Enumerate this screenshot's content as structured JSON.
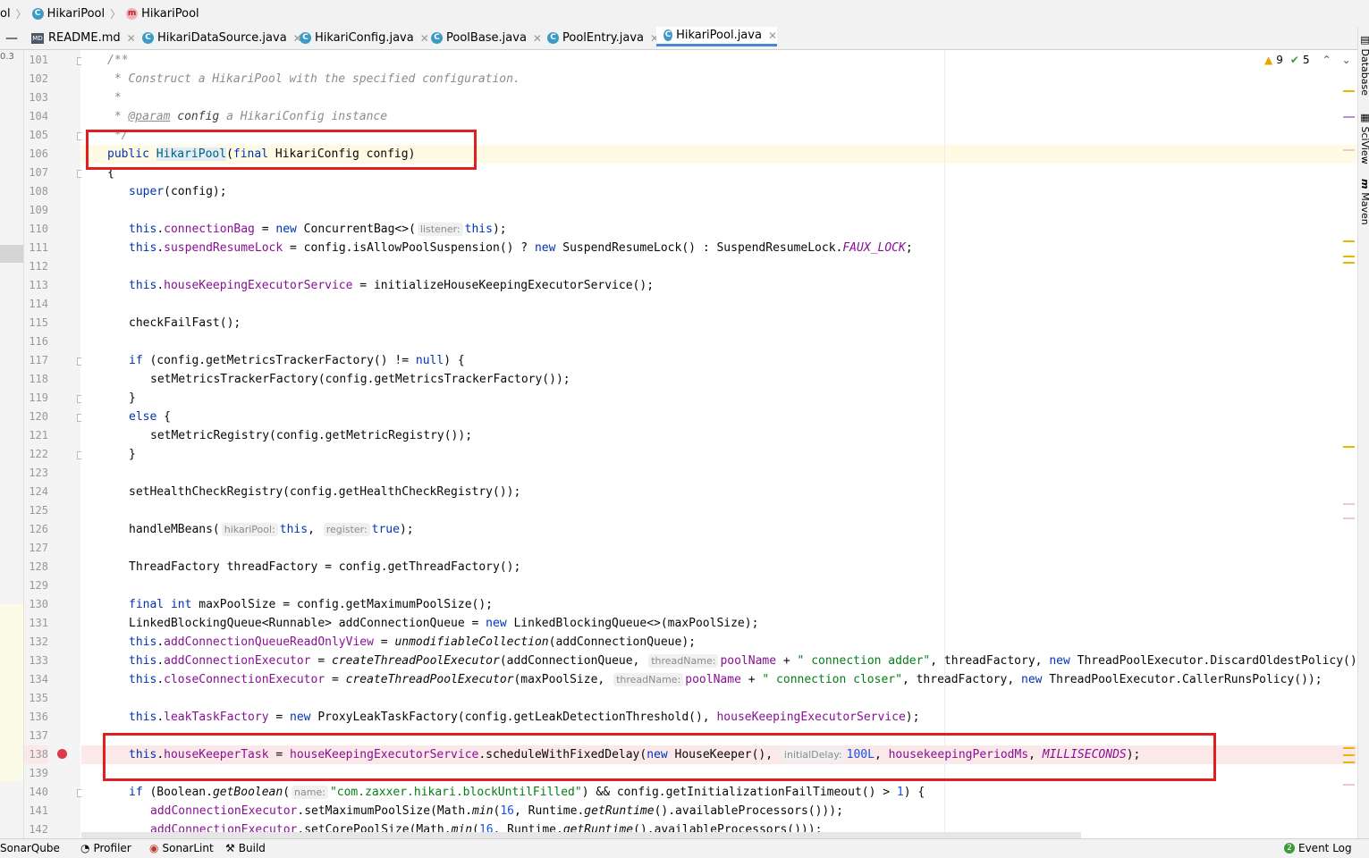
{
  "breadcrumb": {
    "items": [
      {
        "label": "ol",
        "icon": "folder-icon"
      },
      {
        "label": "HikariPool",
        "icon": "class-icon"
      },
      {
        "label": "HikariPool",
        "icon": "method-icon"
      }
    ]
  },
  "tabs": [
    {
      "label": "README.md",
      "icon": "markdown-icon",
      "active": false
    },
    {
      "label": "HikariDataSource.java",
      "icon": "class-icon",
      "active": false
    },
    {
      "label": "HikariConfig.java",
      "icon": "class-icon",
      "active": false
    },
    {
      "label": "PoolBase.java",
      "icon": "class-icon",
      "active": false
    },
    {
      "label": "PoolEntry.java",
      "icon": "class-icon",
      "active": false
    },
    {
      "label": "HikariPool.java",
      "icon": "class-icon",
      "active": true
    }
  ],
  "inspections": {
    "warnings": "9",
    "ok": "5"
  },
  "left_stub": "0.3",
  "right_panels": [
    "Database",
    "SciView",
    "Maven"
  ],
  "line_numbers": [
    "101",
    "102",
    "103",
    "104",
    "105",
    "106",
    "107",
    "108",
    "109",
    "110",
    "111",
    "112",
    "113",
    "114",
    "115",
    "116",
    "117",
    "118",
    "119",
    "120",
    "121",
    "122",
    "123",
    "124",
    "125",
    "126",
    "127",
    "128",
    "129",
    "130",
    "131",
    "132",
    "133",
    "134",
    "135",
    "136",
    "137",
    "138",
    "139",
    "140",
    "141",
    "142"
  ],
  "hints": {
    "listener": "listener:",
    "hikariPool": "hikariPool:",
    "register": "register:",
    "threadName": "threadName:",
    "initialDelay": "initialDelay:",
    "name": "name:"
  },
  "bottom_tools": [
    "SonarQube",
    "Profiler",
    "SonarLint",
    "Build",
    "Event Log"
  ],
  "colors": {
    "highlight_box": "#e02020",
    "keyword": "#0033b3",
    "field": "#871094",
    "string": "#067d17",
    "breakpoint": "#db3b4b"
  }
}
